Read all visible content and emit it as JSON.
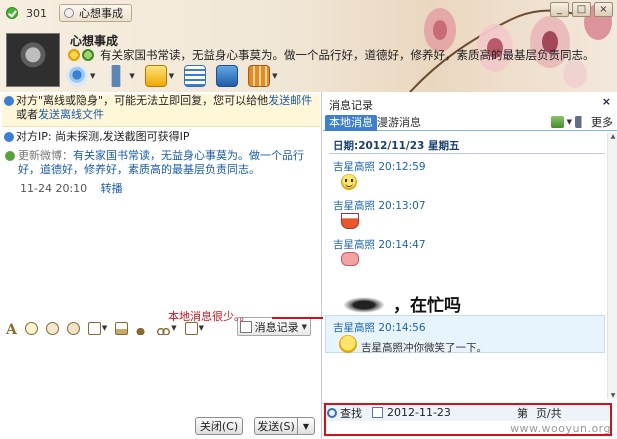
{
  "header": {
    "qq_number": "301",
    "contact_tab": "心想事成",
    "buddy_name": "心想事成",
    "signature": "有关家国书常读，无益身心事莫为。做一个品行好，道德好，修养好，素质高的最基层负责同志。",
    "window_buttons": [
      "_",
      "□",
      "×"
    ]
  },
  "left": {
    "notice1_pre": "对方\"离线或隐身\"，可能无法立即回复，您可以给他",
    "notice1_link1": "发送邮件",
    "notice1_mid": "或者",
    "notice1_link2": "发送离线文件",
    "notice2": "对方IP: 尚未探测,发送截图可获得IP",
    "weibo_head": "更新微博：",
    "weibo_body": "有关家国书常读，无益身心事莫为。做一个品行好，道德好，修养好，素质高的最基层负责同志。",
    "weibo_time": "11-24 20:10",
    "weibo_repost": "转播",
    "history_button": "消息记录",
    "close_button": "关闭(C)",
    "send_button": "发送(S)",
    "send_arrow": "▼"
  },
  "annotation": {
    "text": "本地消息很少。。"
  },
  "right": {
    "title": "消息记录",
    "close": "×",
    "tab_local": "本地消息",
    "tab_roaming": "漫游消息",
    "more": "更多",
    "date_line": "日期:2012/11/23 星期五",
    "messages": [
      {
        "header": "吉星高照 20:12:59"
      },
      {
        "header": "吉星高照 20:13:07"
      },
      {
        "header": "吉星高照 20:14:47"
      },
      {
        "header": "吉星高照 20:14:56"
      }
    ],
    "big_text": "，在忙吗",
    "nudge_text": "吉星高照冲你微笑了一下。",
    "search_label": "查找",
    "search_date": "2012-11-23",
    "page_label": "第",
    "page_total": "页/共"
  },
  "watermark": "www.wooyun.org",
  "colors": {
    "accent_blue": "#3f7fd0",
    "link_blue": "#1a5cb0",
    "annotation_red": "#d0121b"
  },
  "icons": {
    "toolbar": [
      "camera-icon",
      "microphone-icon",
      "file-transfer-icon",
      "message-list-icon",
      "remote-desktop-icon",
      "app-grid-icon"
    ],
    "format": [
      "font-icon",
      "emoji-icon",
      "gift-icon",
      "magic-face-icon",
      "edit-icon",
      "image-icon",
      "music-icon",
      "scissors-icon",
      "screen-icon"
    ]
  }
}
